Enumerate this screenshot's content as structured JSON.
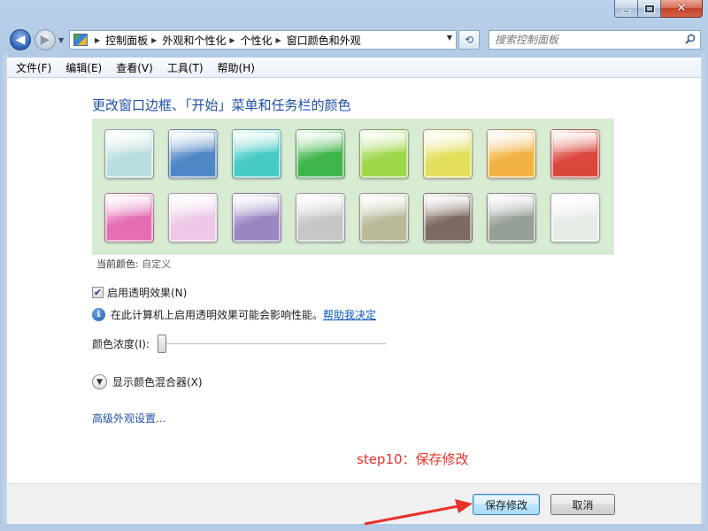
{
  "window": {
    "caption": {
      "minimize": "—",
      "maximize": "□",
      "close": "✕"
    }
  },
  "address": {
    "breadcrumbs": [
      "控制面板",
      "外观和个性化",
      "个性化",
      "窗口颜色和外观"
    ],
    "search_placeholder": "搜索控制面板"
  },
  "menu": [
    "文件(F)",
    "编辑(E)",
    "查看(V)",
    "工具(T)",
    "帮助(H)"
  ],
  "main": {
    "heading": "更改窗口边框、「开始」菜单和任务栏的颜色",
    "swatches": [
      {
        "name": "sky",
        "color": "#b9dcdc"
      },
      {
        "name": "twilight",
        "color": "#4f86c6"
      },
      {
        "name": "sea",
        "color": "#45cac4"
      },
      {
        "name": "leaf",
        "color": "#3fb54a"
      },
      {
        "name": "lime",
        "color": "#9ed64a"
      },
      {
        "name": "lemon",
        "color": "#e3df5a"
      },
      {
        "name": "tangerine",
        "color": "#f2b343"
      },
      {
        "name": "ruby",
        "color": "#d9473d"
      },
      {
        "name": "fuchsia",
        "color": "#e46db4"
      },
      {
        "name": "blush",
        "color": "#ecc7e6"
      },
      {
        "name": "violet",
        "color": "#9a86c2"
      },
      {
        "name": "lavender",
        "color": "#c6c6c6"
      },
      {
        "name": "taupe",
        "color": "#b9b99a"
      },
      {
        "name": "chocolate",
        "color": "#7d6a60"
      },
      {
        "name": "slate",
        "color": "#96a096"
      },
      {
        "name": "frost",
        "color": "#e6ebe6"
      }
    ],
    "current_color_label": "当前颜色:",
    "current_color_value": "自定义",
    "transparency_label": "启用透明效果(N)",
    "transparency_checked": true,
    "info_text": "在此计算机上启用透明效果可能会影响性能。",
    "help_link": "帮助我决定",
    "intensity_label": "颜色浓度(I):",
    "intensity_value": 0,
    "mixer_label": "显示颜色混合器(X)",
    "advanced_link": "高级外观设置..."
  },
  "annotation": {
    "text": "step10：保存修改",
    "color": "#e8322b"
  },
  "footer": {
    "save_label": "保存修改",
    "cancel_label": "取消"
  }
}
